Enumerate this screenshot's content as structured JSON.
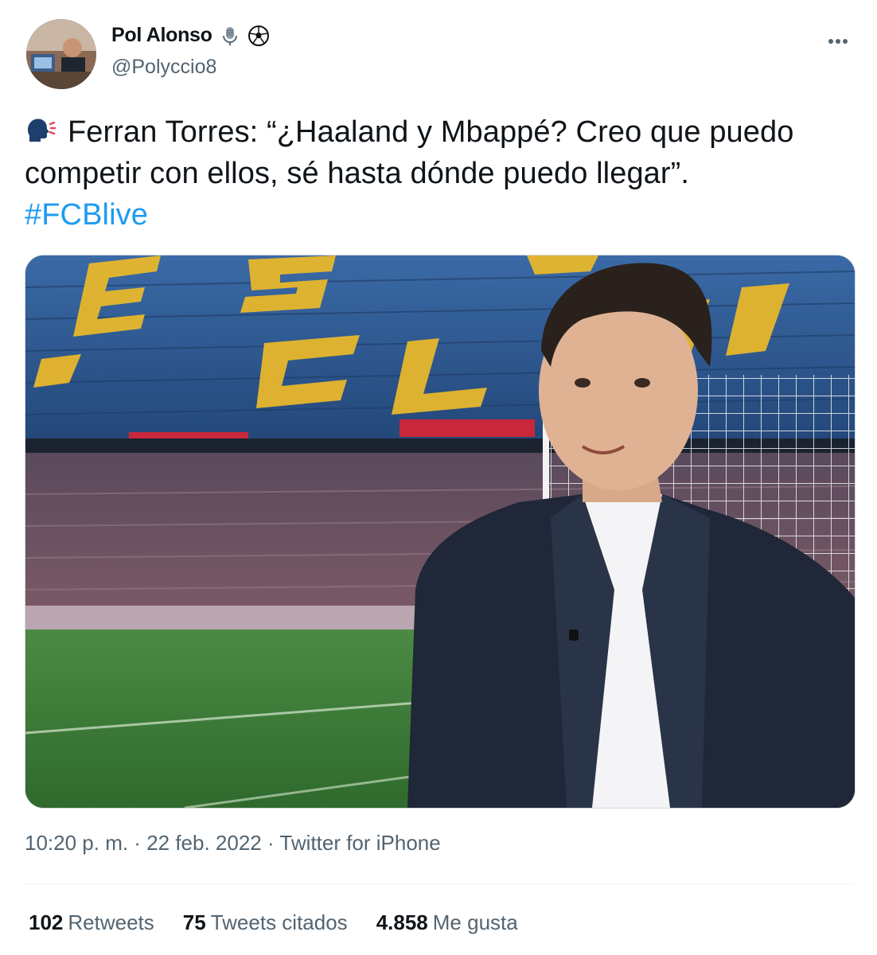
{
  "author": {
    "display_name": "Pol Alonso",
    "handle": "@Polyccio8",
    "name_emojis": [
      "microphone-icon",
      "soccer-ball-icon"
    ]
  },
  "tweet": {
    "text_icon": "speaking-head-icon",
    "text_main": "Ferran Torres: “¿Haaland y Mbappé? Creo que puedo competir con ellos, sé hasta dónde puedo llegar”. ",
    "hashtag": "#FCBlive"
  },
  "meta": {
    "time": "10:20 p. m.",
    "separator": " · ",
    "date": "22 feb. 2022",
    "source": "Twitter for iPhone"
  },
  "stats": {
    "retweets_count": "102",
    "retweets_label": "Retweets",
    "quotes_count": "75",
    "quotes_label": "Tweets citados",
    "likes_count": "4.858",
    "likes_label": "Me gusta"
  },
  "colors": {
    "text": "#0f1419",
    "secondary": "#536471",
    "link": "#1d9bf0",
    "stadium_seat_blue": "#2f5f9a",
    "stadium_letter_yellow": "#e8b72c",
    "pitch_green": "#3e7a3a"
  }
}
